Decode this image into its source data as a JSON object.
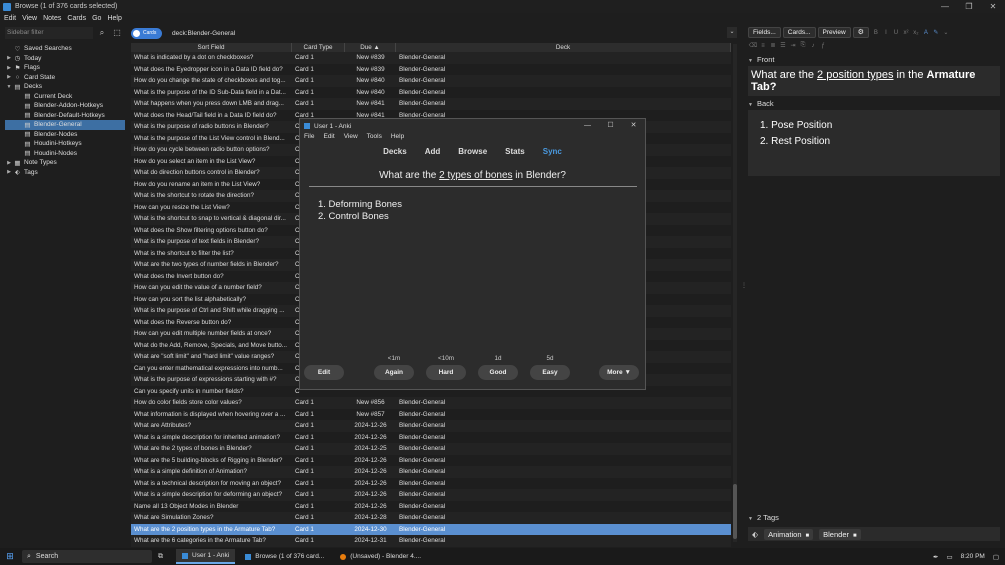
{
  "window": {
    "title": "Browse (1 of 376 cards selected)",
    "controls": [
      "—",
      "❐",
      "✕"
    ]
  },
  "menubar": [
    "Edit",
    "View",
    "Notes",
    "Cards",
    "Go",
    "Help"
  ],
  "sidebar": {
    "search_placeholder": "Sidebar filter",
    "items": [
      {
        "label": "Saved Searches",
        "icon": "filter-icon",
        "level": 0,
        "arrow": ""
      },
      {
        "label": "Today",
        "icon": "clock-icon",
        "level": 0,
        "arrow": "▶"
      },
      {
        "label": "Flags",
        "icon": "flag-icon",
        "level": 0,
        "arrow": "▶"
      },
      {
        "label": "Card State",
        "icon": "circle-icon",
        "level": 0,
        "arrow": "▶"
      },
      {
        "label": "Decks",
        "icon": "deck-icon",
        "level": 0,
        "arrow": "▼"
      },
      {
        "label": "Current Deck",
        "icon": "deck-icon",
        "level": 1,
        "arrow": ""
      },
      {
        "label": "Blender-Addon-Hotkeys",
        "icon": "deck-icon",
        "level": 1,
        "arrow": ""
      },
      {
        "label": "Blender-Default-Hotkeys",
        "icon": "deck-icon",
        "level": 1,
        "arrow": ""
      },
      {
        "label": "Blender-General",
        "icon": "deck-icon",
        "level": 1,
        "arrow": "",
        "selected": true
      },
      {
        "label": "Blender-Nodes",
        "icon": "deck-icon",
        "level": 1,
        "arrow": ""
      },
      {
        "label": "Houdini-Hotkeys",
        "icon": "deck-icon",
        "level": 1,
        "arrow": ""
      },
      {
        "label": "Houdini-Nodes",
        "icon": "deck-icon",
        "level": 1,
        "arrow": ""
      },
      {
        "label": "Note Types",
        "icon": "notetype-icon",
        "level": 0,
        "arrow": "▶"
      },
      {
        "label": "Tags",
        "icon": "tag-icon",
        "level": 0,
        "arrow": "▶"
      }
    ]
  },
  "search": {
    "toggle_label": "Cards",
    "query": "deck:Blender-General"
  },
  "table": {
    "headers": [
      "Sort Field",
      "Card Type",
      "Due",
      "Deck"
    ],
    "rows": [
      [
        "What is indicated by a dot on checkboxes?",
        "Card 1",
        "New #839",
        "Blender-General"
      ],
      [
        "What does the Eyedropper icon in a Data ID field do?",
        "Card 1",
        "New #839",
        "Blender-General"
      ],
      [
        "How do you change the state of checkboxes and tog...",
        "Card 1",
        "New #840",
        "Blender-General"
      ],
      [
        "What is the purpose of the ID Sub-Data field in a Dat...",
        "Card 1",
        "New #840",
        "Blender-General"
      ],
      [
        "What happens when you press down LMB and drag...",
        "Card 1",
        "New #841",
        "Blender-General"
      ],
      [
        "What does the Head/Tail field in a Data ID field do?",
        "Card 1",
        "New #841",
        "Blender-General"
      ],
      [
        "What is the purpose of radio buttons in Blender?",
        "C",
        "",
        ""
      ],
      [
        "What is the purpose of the List View control in Blend...",
        "C",
        "",
        ""
      ],
      [
        "How do you cycle between radio button options?",
        "C",
        "",
        ""
      ],
      [
        "How do you select an item in the List View?",
        "C",
        "",
        ""
      ],
      [
        "What do direction buttons control in Blender?",
        "C",
        "",
        ""
      ],
      [
        "How do you rename an item in the List View?",
        "C",
        "",
        ""
      ],
      [
        "What is the shortcut to rotate the direction?",
        "C",
        "",
        ""
      ],
      [
        "How can you resize the List View?",
        "C",
        "",
        ""
      ],
      [
        "What is the shortcut to snap to vertical & diagonal dir...",
        "C",
        "",
        ""
      ],
      [
        "What does the Show filtering options button do?",
        "C",
        "",
        ""
      ],
      [
        "What is the purpose of text fields in Blender?",
        "C",
        "",
        ""
      ],
      [
        "What is the shortcut to filter the list?",
        "C",
        "",
        ""
      ],
      [
        "What are the two types of number fields in Blender?",
        "C",
        "",
        ""
      ],
      [
        "What does the Invert button do?",
        "C",
        "",
        ""
      ],
      [
        "How can you edit the value of a number field?",
        "C",
        "",
        ""
      ],
      [
        "How can you sort the list alphabetically?",
        "C",
        "",
        ""
      ],
      [
        "What is the purpose of Ctrl and Shift while dragging ...",
        "C",
        "",
        ""
      ],
      [
        "What does the Reverse button do?",
        "C",
        "",
        ""
      ],
      [
        "How can you edit multiple number fields at once?",
        "C",
        "",
        ""
      ],
      [
        "What do the Add, Remove, Specials, and Move butto...",
        "C",
        "",
        ""
      ],
      [
        "What are \"soft limit\" and \"hard limit\" value ranges?",
        "C",
        "",
        ""
      ],
      [
        "Can you enter mathematical expressions into numb...",
        "C",
        "",
        ""
      ],
      [
        "What is the purpose of expressions starting with #?",
        "C",
        "",
        ""
      ],
      [
        "Can you specify units in number fields?",
        "C",
        "",
        ""
      ],
      [
        "How do color fields store color values?",
        "Card 1",
        "New #856",
        "Blender-General"
      ],
      [
        "What information is displayed when hovering over a ...",
        "Card 1",
        "New #857",
        "Blender-General"
      ],
      [
        "What are Attributes?",
        "Card 1",
        "2024-12-26",
        "Blender-General"
      ],
      [
        "What is a simple description for inherited animation?",
        "Card 1",
        "2024-12-26",
        "Blender-General"
      ],
      [
        "What are the 2 types of bones in Blender?",
        "Card 1",
        "2024-12-25",
        "Blender-General"
      ],
      [
        "What are the 5 building-blocks of Rigging in Blender?",
        "Card 1",
        "2024-12-26",
        "Blender-General"
      ],
      [
        "What is a simple definition of Animation?",
        "Card 1",
        "2024-12-26",
        "Blender-General"
      ],
      [
        "What is a technical description for moving an object?",
        "Card 1",
        "2024-12-26",
        "Blender-General"
      ],
      [
        "What is a simple description for deforming an object?",
        "Card 1",
        "2024-12-26",
        "Blender-General"
      ],
      [
        "Name all 13 Object Modes in Blender",
        "Card 1",
        "2024-12-26",
        "Blender-General"
      ],
      [
        "What are Simulation Zones?",
        "Card 1",
        "2024-12-28",
        "Blender-General"
      ],
      [
        "What are the 2 position types in the Armature Tab?",
        "Card 1",
        "2024-12-30",
        "Blender-General"
      ],
      [
        "What are the 6 categories in the Armature Tab?",
        "Card 1",
        "2024-12-31",
        "Blender-General"
      ]
    ],
    "selected_index": 41
  },
  "editor": {
    "buttons": [
      "Fields...",
      "Cards...",
      "Preview"
    ],
    "front_label": "Front",
    "front_pre": "What are the ",
    "front_underline": "2 position types",
    "front_mid": " in the ",
    "front_bold": "Armature Tab?",
    "back_label": "Back",
    "back_items": [
      "1. Pose Position",
      "2. Rest Position"
    ],
    "tags_label": "2 Tags",
    "tags": [
      "Animation",
      "Blender"
    ]
  },
  "review_window": {
    "title": "User 1 - Anki",
    "menu": [
      "File",
      "Edit",
      "View",
      "Tools",
      "Help"
    ],
    "nav": [
      "Decks",
      "Add",
      "Browse",
      "Stats",
      "Sync"
    ],
    "question_pre": "What are the ",
    "question_underline": "2 types of bones",
    "question_post": " in Blender?",
    "answers": [
      "1. Deforming Bones",
      "2. Control Bones"
    ],
    "edit_label": "Edit",
    "more_label": "More ▼",
    "intervals": [
      "<1m",
      "<10m",
      "1d",
      "5d"
    ],
    "buttons": [
      "Again",
      "Hard",
      "Good",
      "Easy"
    ]
  },
  "taskbar": {
    "search_label": "Search",
    "apps": [
      "User 1 - Anki",
      "Browse (1 of 376 card...",
      "(Unsaved) - Blender 4...."
    ],
    "time": "8:20 PM"
  },
  "colors": {
    "accent": "#3a7bd5",
    "selection": "#5a8fd0",
    "sync": "#4a9ae0"
  }
}
